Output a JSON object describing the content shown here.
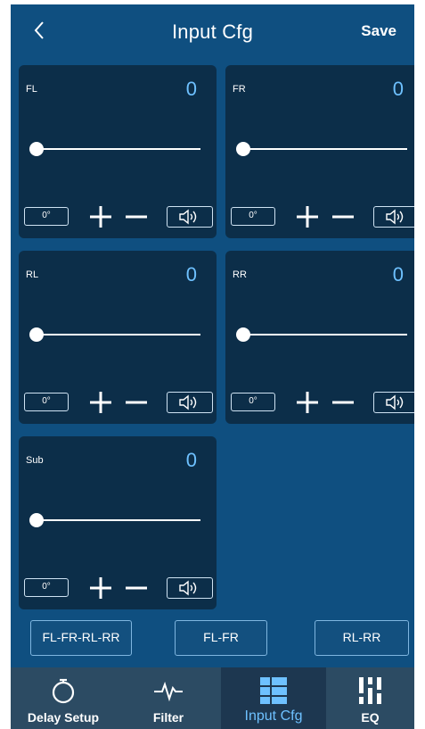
{
  "header": {
    "title": "Input Cfg",
    "save_label": "Save",
    "back_icon": "chevron-left-icon"
  },
  "channels": [
    {
      "label": "FL",
      "value": "0",
      "slider_level": 0,
      "phase_label": "0°"
    },
    {
      "label": "FR",
      "value": "0",
      "slider_level": 0,
      "phase_label": "0°"
    },
    {
      "label": "RL",
      "value": "0",
      "slider_level": 0,
      "phase_label": "0°"
    },
    {
      "label": "RR",
      "value": "0",
      "slider_level": 0,
      "phase_label": "0°"
    },
    {
      "label": "Sub",
      "value": "0",
      "slider_level": 0,
      "phase_label": "0°"
    }
  ],
  "groups": [
    {
      "label": "FL-FR-RL-RR"
    },
    {
      "label": "FL-FR"
    },
    {
      "label": "RL-RR"
    }
  ],
  "nav": [
    {
      "label": "Delay Setup",
      "icon": "stopwatch-icon",
      "active": false
    },
    {
      "label": "Filter",
      "icon": "waveform-icon",
      "active": false
    },
    {
      "label": "Input Cfg",
      "icon": "grid-layout-icon",
      "active": true
    },
    {
      "label": "EQ",
      "icon": "equalizer-sliders-icon",
      "active": false
    }
  ],
  "colors": {
    "background": "#0f4f80",
    "card": "#0c2e49",
    "value_text": "#6ec1ff",
    "nav_bar": "#2c4b63",
    "nav_active": "#1d3750"
  }
}
